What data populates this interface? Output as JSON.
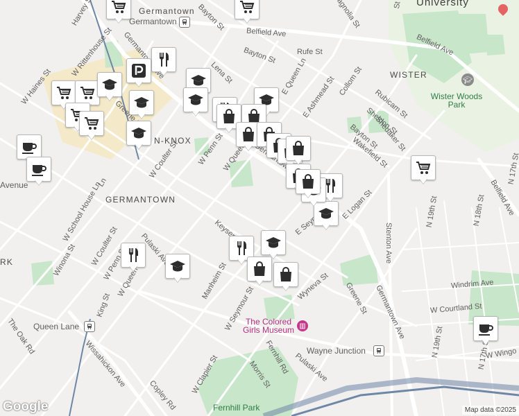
{
  "map": {
    "colors": {
      "land": "#f1f0ef",
      "road": "#ffffff",
      "park": "#c8e6c9",
      "campus": "#eaf3e3",
      "commercial": "#f4e9c9",
      "rail": "#6f87a6",
      "marker_icon": "#2e2e2e"
    },
    "attribution": "Map data ©2025",
    "logo": "Google"
  },
  "labels": {
    "streets": [
      {
        "id": "harvey",
        "text": "Harvey St"
      },
      {
        "id": "w-rittenhouse",
        "text": "W Rittenhouse St"
      },
      {
        "id": "w-haines",
        "text": "W Haines St"
      },
      {
        "id": "germantown-ave-nw",
        "text": "Germantown Ave"
      },
      {
        "id": "greene",
        "text": "Greene St"
      },
      {
        "id": "bayton",
        "text": "Bayton St"
      },
      {
        "id": "belfield-ave",
        "text": "Belfield Ave"
      },
      {
        "id": "rufe",
        "text": "Rufe St"
      },
      {
        "id": "bayton-2",
        "text": "Bayton St"
      },
      {
        "id": "lena",
        "text": "Lena St"
      },
      {
        "id": "e-queen-ln",
        "text": "E Queen Ln"
      },
      {
        "id": "e-ashmead",
        "text": "E Ashmead St"
      },
      {
        "id": "collom",
        "text": "Collom St"
      },
      {
        "id": "magnolia",
        "text": "Magnolia St"
      },
      {
        "id": "belfield-ave-2",
        "text": "Belfield Ave"
      },
      {
        "id": "rubicam",
        "text": "Rubicam St"
      },
      {
        "id": "sheldon",
        "text": "Sheldon St"
      },
      {
        "id": "bayton-3",
        "text": "Bayton St"
      },
      {
        "id": "shedaker",
        "text": "Shedaker St"
      },
      {
        "id": "wakefield",
        "text": "Wakefield St"
      },
      {
        "id": "w-penn",
        "text": "W Penn St"
      },
      {
        "id": "w-queen-ln",
        "text": "W Queen Ln"
      },
      {
        "id": "w-coulter",
        "text": "W Coulter St"
      },
      {
        "id": "germantown-ave-mid",
        "text": "Germantown Ave"
      },
      {
        "id": "e-logan",
        "text": "E Logan St"
      },
      {
        "id": "seymour",
        "text": "E Seymour St"
      },
      {
        "id": "w-school-house",
        "text": "W School House Ln"
      },
      {
        "id": "winona",
        "text": "Winona St"
      },
      {
        "id": "w-coulter-2",
        "text": "W Coulter St"
      },
      {
        "id": "pulaski",
        "text": "Pulaski Ave"
      },
      {
        "id": "w-penn-2",
        "text": "W Penn St"
      },
      {
        "id": "w-queen-2",
        "text": "W Queen Ln"
      },
      {
        "id": "keyser",
        "text": "Keyser St"
      },
      {
        "id": "manheim",
        "text": "Manheim St"
      },
      {
        "id": "w-seymour",
        "text": "W Seymour St"
      },
      {
        "id": "wyneva",
        "text": "Wyneva St"
      },
      {
        "id": "greene-2",
        "text": "Greene St"
      },
      {
        "id": "stenton",
        "text": "Stenton Ave"
      },
      {
        "id": "germantown-ave-se",
        "text": "Germantown Ave"
      },
      {
        "id": "king",
        "text": "King St"
      },
      {
        "id": "oak-rd",
        "text": "The Oak Rd"
      },
      {
        "id": "wissahickon",
        "text": "Wissahickon Ave"
      },
      {
        "id": "copley",
        "text": "Copley Rd"
      },
      {
        "id": "w-clapier",
        "text": "W Clapier St"
      },
      {
        "id": "fernhill-rd",
        "text": "Fernhill Rd"
      },
      {
        "id": "morris",
        "text": "Morris St"
      },
      {
        "id": "pulaski-2",
        "text": "Pulaski Ave"
      },
      {
        "id": "windrim",
        "text": "Windrim Ave"
      },
      {
        "id": "w-courtland",
        "text": "W Courtland St"
      },
      {
        "id": "n-19th",
        "text": "N 19th St"
      },
      {
        "id": "n-18th",
        "text": "N 18th St"
      },
      {
        "id": "n-17th",
        "text": "N 17th St"
      },
      {
        "id": "n-19th-2",
        "text": "N 19th St"
      },
      {
        "id": "n-17th-2",
        "text": "N 17th St"
      },
      {
        "id": "belfield-ave-3",
        "text": "Belfield Ave"
      },
      {
        "id": "w-wingo",
        "text": "W Wingo"
      },
      {
        "id": "avenue",
        "text": "Avenue"
      },
      {
        "id": "ln",
        "text": "Ln"
      },
      {
        "id": "st-n",
        "text": "St"
      }
    ],
    "areas": [
      {
        "id": "germantown-top",
        "text": "Germantown"
      },
      {
        "id": "germantown",
        "text": "GERMANTOWN"
      },
      {
        "id": "wister",
        "text": "WISTER"
      },
      {
        "id": "n-knox",
        "text": "N-KNOX"
      },
      {
        "id": "university",
        "text": "University"
      },
      {
        "id": "rk",
        "text": "RK"
      }
    ],
    "parks": [
      {
        "id": "wister-woods",
        "text": "Wister Woods Park"
      },
      {
        "id": "fernhill",
        "text": "Fernhill Park"
      }
    ],
    "pois": [
      {
        "id": "colored-girls",
        "text": "The Colored Girls Museum"
      }
    ],
    "stations": [
      {
        "id": "germantown-station",
        "text": "Germantown"
      },
      {
        "id": "queen-lane-station",
        "text": "Queen Lane"
      },
      {
        "id": "wayne-junction-station",
        "text": "Wayne Junction"
      }
    ]
  },
  "markers": [
    {
      "name": "shopping-cart-icon",
      "icon": "cart"
    },
    {
      "name": "shopping-cart-icon",
      "icon": "cart"
    },
    {
      "name": "shopping-cart-icon",
      "icon": "cart"
    },
    {
      "name": "shopping-cart-icon",
      "icon": "cart"
    },
    {
      "name": "shopping-cart-icon",
      "icon": "cart"
    },
    {
      "name": "shopping-cart-icon",
      "icon": "cart"
    },
    {
      "name": "shopping-cart-icon",
      "icon": "cart"
    },
    {
      "name": "restaurant-icon",
      "icon": "fork"
    },
    {
      "name": "restaurant-icon",
      "icon": "fork"
    },
    {
      "name": "restaurant-icon",
      "icon": "fork"
    },
    {
      "name": "restaurant-icon",
      "icon": "fork"
    },
    {
      "name": "restaurant-icon",
      "icon": "fork"
    },
    {
      "name": "school-icon",
      "icon": "school"
    },
    {
      "name": "school-icon",
      "icon": "school"
    },
    {
      "name": "school-icon",
      "icon": "school"
    },
    {
      "name": "school-icon",
      "icon": "school"
    },
    {
      "name": "school-icon",
      "icon": "school"
    },
    {
      "name": "school-icon",
      "icon": "school"
    },
    {
      "name": "school-icon",
      "icon": "school"
    },
    {
      "name": "school-icon",
      "icon": "school"
    },
    {
      "name": "school-icon",
      "icon": "school"
    },
    {
      "name": "school-icon",
      "icon": "school"
    },
    {
      "name": "shopping-bag-icon",
      "icon": "bag"
    },
    {
      "name": "shopping-bag-icon",
      "icon": "bag"
    },
    {
      "name": "shopping-bag-icon",
      "icon": "bag"
    },
    {
      "name": "shopping-bag-icon",
      "icon": "bag"
    },
    {
      "name": "shopping-bag-icon",
      "icon": "bag"
    },
    {
      "name": "shopping-bag-icon",
      "icon": "bag"
    },
    {
      "name": "shopping-bag-icon",
      "icon": "bag"
    },
    {
      "name": "shopping-bag-icon",
      "icon": "bag"
    },
    {
      "name": "shopping-bag-icon",
      "icon": "bag"
    },
    {
      "name": "shopping-bag-icon",
      "icon": "bag"
    },
    {
      "name": "shopping-bag-icon",
      "icon": "bag"
    },
    {
      "name": "cafe-icon",
      "icon": "cup"
    },
    {
      "name": "cafe-icon",
      "icon": "cup"
    },
    {
      "name": "cafe-icon",
      "icon": "cup"
    },
    {
      "name": "parking-icon",
      "icon": "parking"
    }
  ]
}
